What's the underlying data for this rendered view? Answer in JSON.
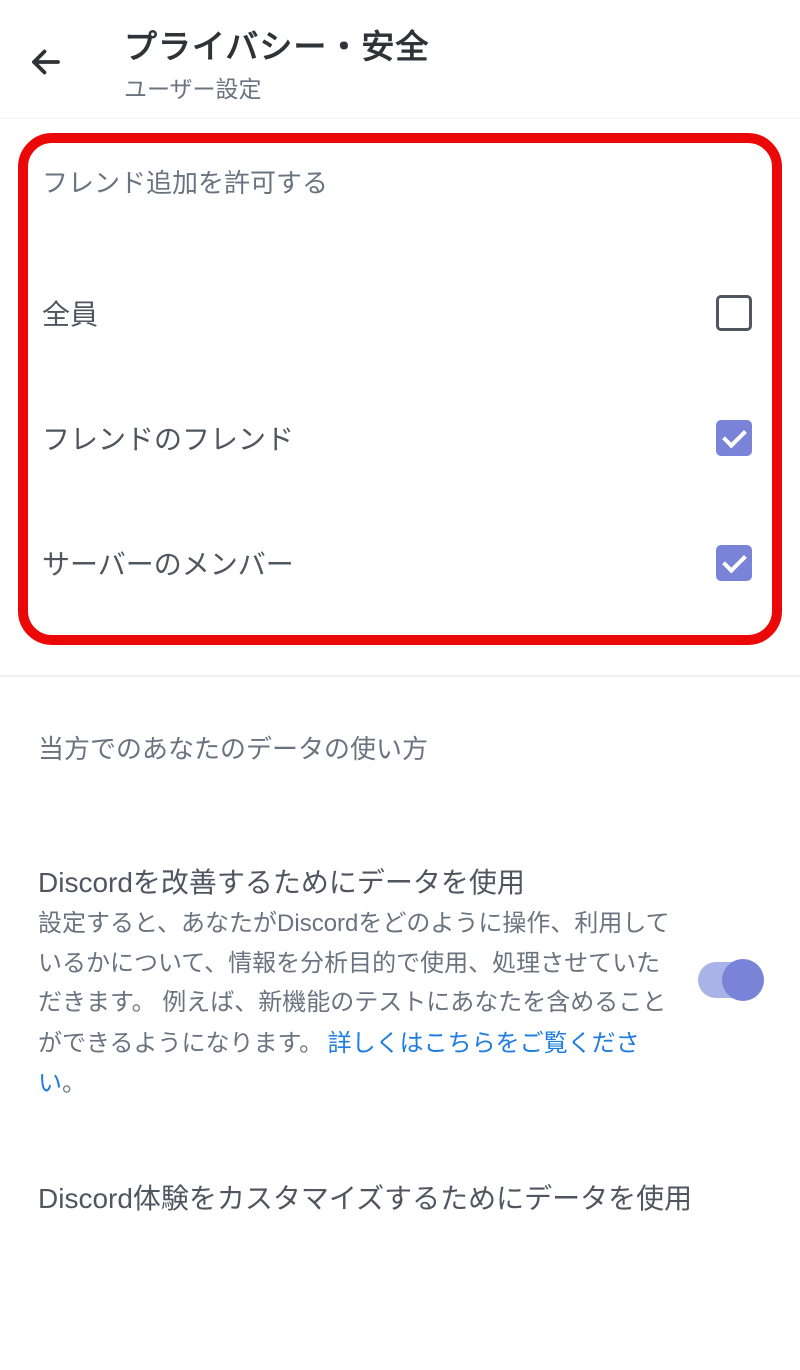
{
  "header": {
    "title": "プライバシー・安全",
    "subtitle": "ユーザー設定"
  },
  "friend_section": {
    "header": "フレンド追加を許可する",
    "options": [
      {
        "label": "全員",
        "checked": false
      },
      {
        "label": "フレンドのフレンド",
        "checked": true
      },
      {
        "label": "サーバーのメンバー",
        "checked": true
      }
    ]
  },
  "data_section": {
    "header": "当方でのあなたのデータの使い方",
    "item1": {
      "title": "Discordを改善するためにデータを使用",
      "description": "設定すると、あなたがDiscordをどのように操作、利用しているかについて、情報を分析目的で使用、処理させていただきます。 例えば、新機能のテストにあなたを含めることができるようになります。",
      "link_text": "詳しくはこちらをご覧ください",
      "period": "。",
      "toggle_on": true
    },
    "item2": {
      "title": "Discord体験をカスタマイズするためにデータを使用"
    }
  }
}
